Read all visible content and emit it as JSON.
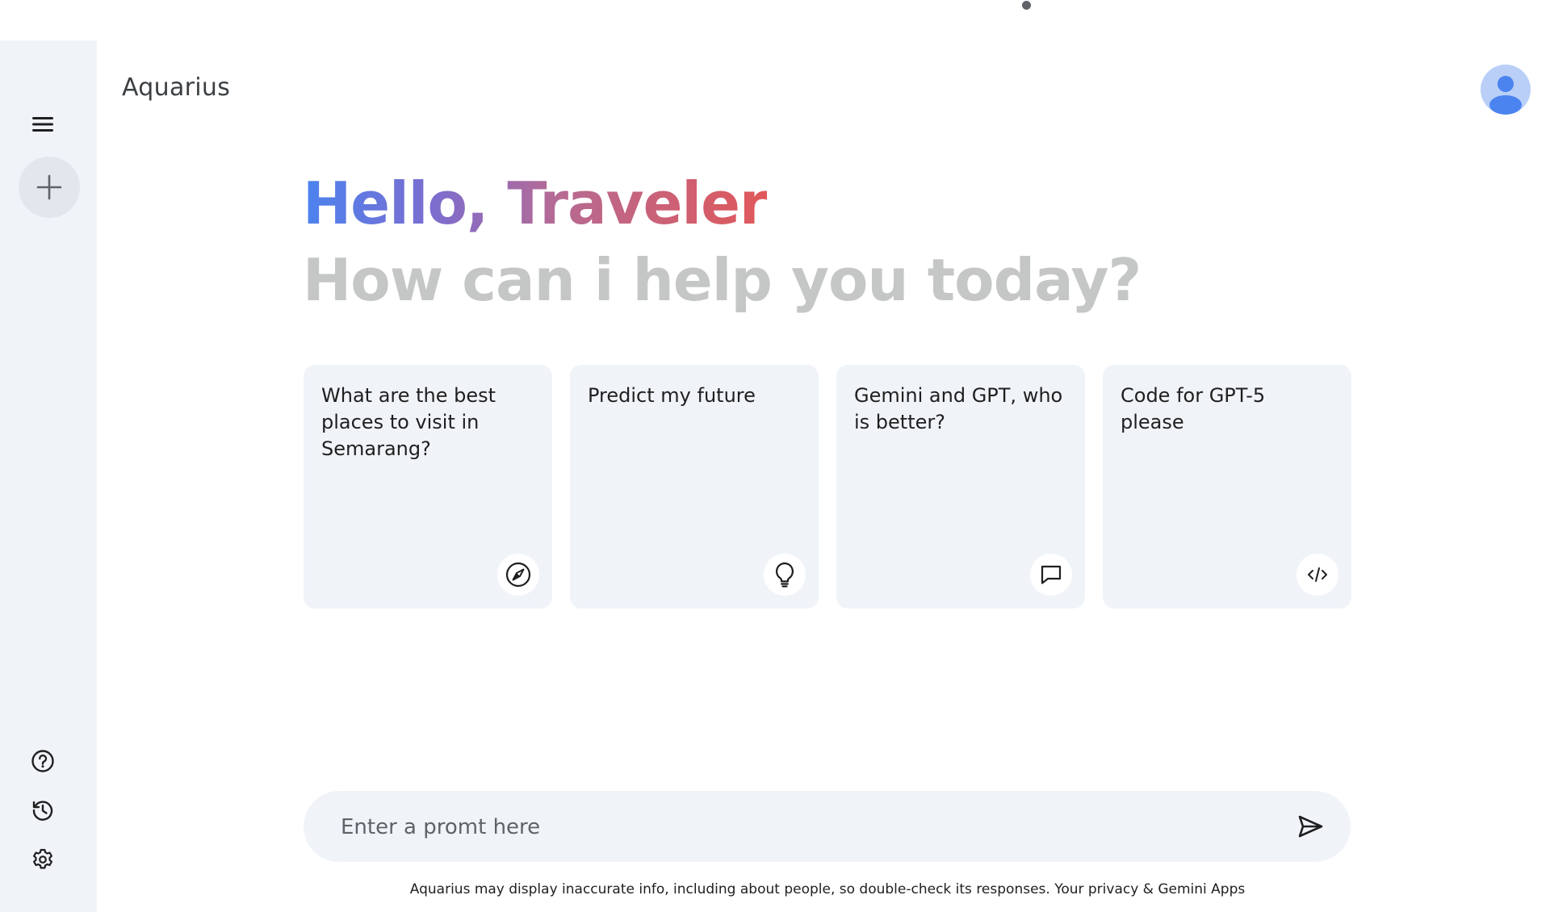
{
  "app": {
    "title": "Aquarius"
  },
  "greeting": {
    "hello": "Hello, Traveler",
    "subtitle": "How can i help you today?"
  },
  "cards": [
    {
      "text": "What are the best places to visit in Semarang?",
      "icon": "compass-icon"
    },
    {
      "text": "Predict my future",
      "icon": "lightbulb-icon"
    },
    {
      "text": "Gemini and GPT, who is better?",
      "icon": "chat-icon"
    },
    {
      "text": "Code for GPT-5 please",
      "icon": "code-icon"
    }
  ],
  "prompt": {
    "placeholder": "Enter a promt here",
    "value": ""
  },
  "footer": {
    "disclaimer": "Aquarius may display inaccurate info, including about people, so double-check its responses. Your privacy & Gemini Apps"
  },
  "sidebar": {
    "icons": [
      "menu-icon",
      "plus-icon",
      "help-icon",
      "history-icon",
      "settings-icon"
    ]
  },
  "colors": {
    "sidebar_bg": "#f0f4f9",
    "card_bg": "#f0f4f9",
    "greeting_gradient": [
      "#4b83ef",
      "#7c6dcf",
      "#b66a93",
      "#e0585a"
    ],
    "subtitle": "#c4c7c5",
    "avatar_bg": "#b9cff8",
    "avatar_fg": "#4b83ef"
  }
}
